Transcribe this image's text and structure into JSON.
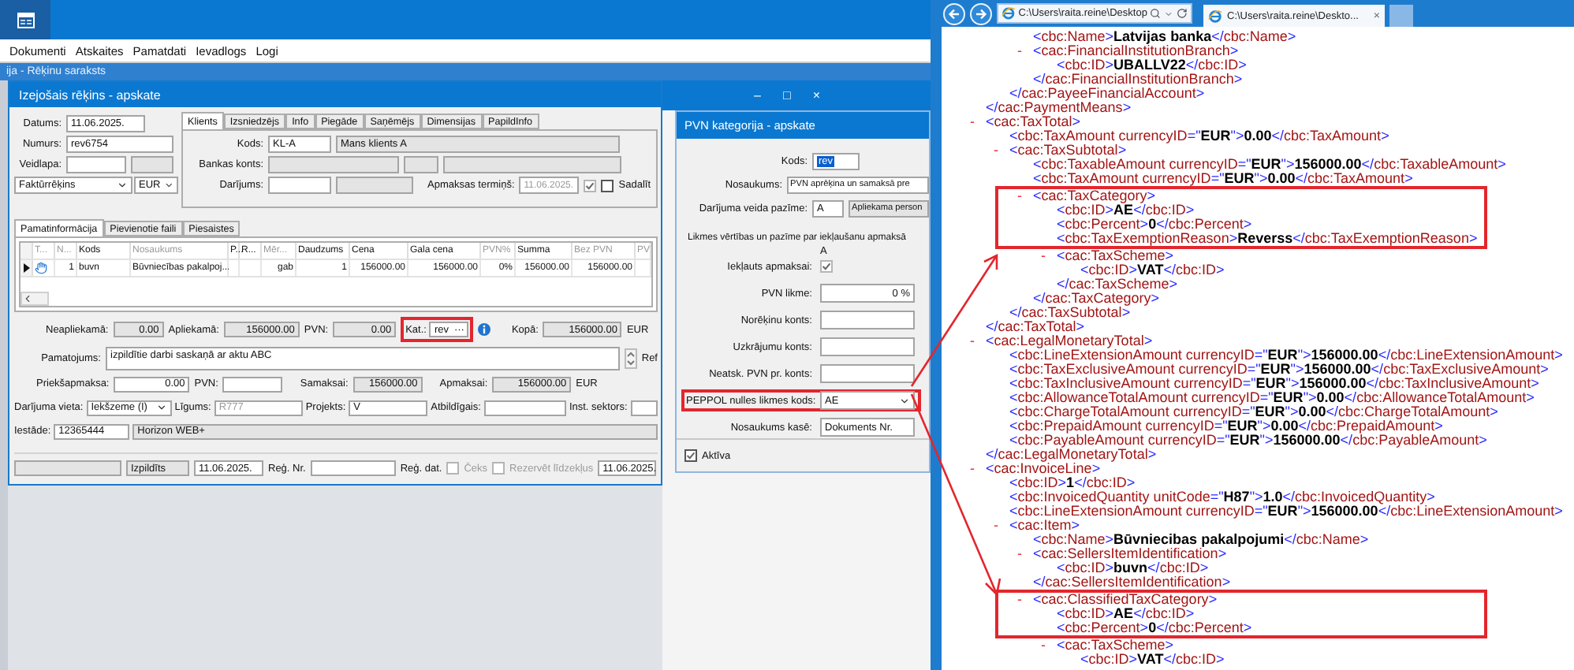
{
  "app": {
    "menu": [
      "Dokumenti",
      "Atskaites",
      "Pamatdati",
      "Ievadlogs",
      "Logi"
    ],
    "background_window_title": "ija - Rēķinu saraksts"
  },
  "invoice": {
    "title": "Izejošais rēķins - apskate",
    "datums": {
      "label": "Datums:",
      "value": "11.06.2025."
    },
    "numurs": {
      "label": "Numurs:",
      "value": "rev6754"
    },
    "veidlapa": {
      "label": "Veidlapa:"
    },
    "doc_type": "Faktūrrēķins",
    "currency": "EUR",
    "client_tabs": [
      {
        "label": "Klients",
        "selected": true
      },
      {
        "label": "Izsniedzējs",
        "selected": false
      },
      {
        "label": "Info",
        "selected": false
      },
      {
        "label": "Piegāde",
        "selected": false
      },
      {
        "label": "Saņēmējs",
        "selected": false
      },
      {
        "label": "Dimensijas",
        "selected": false
      },
      {
        "label": "PapildInfo",
        "selected": false
      }
    ],
    "client": {
      "kods_label": "Kods:",
      "kods": "KL-A",
      "name": "Mans klients A",
      "bank_label": "Bankas konts:",
      "darijums_label": "Darījums:",
      "term_label": "Apmaksas termiņš:",
      "term": "11.06.2025.",
      "term_checked": true,
      "split_label": "Sadalīt",
      "split_checked": false
    },
    "tabs": [
      {
        "label": "Pamatinformācija",
        "selected": true
      },
      {
        "label": "Pievienotie faili",
        "selected": false
      },
      {
        "label": "Piesaistes",
        "selected": false
      }
    ],
    "grid": {
      "columns": [
        {
          "label": "T...",
          "dimmed": true
        },
        {
          "label": "N...",
          "dimmed": true
        },
        {
          "label": "Kods",
          "dimmed": false
        },
        {
          "label": "Nosaukums",
          "dimmed": true
        },
        {
          "label": "P...",
          "dimmed": false
        },
        {
          "label": "R...",
          "dimmed": false
        },
        {
          "label": "Mēr...",
          "dimmed": true
        },
        {
          "label": "Daudzums",
          "dimmed": false
        },
        {
          "label": "Cena",
          "dimmed": false
        },
        {
          "label": "Gala cena",
          "dimmed": false
        },
        {
          "label": "PVN%",
          "dimmed": true
        },
        {
          "label": "Summa",
          "dimmed": false
        },
        {
          "label": "Bez PVN",
          "dimmed": true
        },
        {
          "label": "PV",
          "dimmed": true
        }
      ],
      "rows": [
        {
          "selected": true,
          "cells": [
            null,
            "1",
            "buvn",
            "Būvniecības pakalpoj...",
            null,
            null,
            "gab",
            "1",
            "156000.00",
            "156000.00",
            "0%",
            "156000.00",
            "156000.00",
            null
          ]
        }
      ]
    },
    "totals": [
      {
        "label": "Neapliekamā:",
        "value": "0.00"
      },
      {
        "label": "Apliekamā:",
        "value": "156000.00"
      },
      {
        "label": "PVN:",
        "value": "0.00"
      }
    ],
    "kat": {
      "label": "Kat.:",
      "value": "rev",
      "button": "···",
      "highlighted": true
    },
    "kopa": {
      "label": "Kopā:",
      "value": "156000.00",
      "currency": "EUR"
    },
    "pamatojums": {
      "label": "Pamatojums:",
      "value": "izpildītie darbi saskaņā ar aktu ABC",
      "ref_label": "Ref"
    },
    "payment": {
      "prepay_label": "Priekšapmaksa:",
      "prepay": "0.00",
      "pvn_label": "PVN:",
      "samaksai_label": "Samaksai:",
      "samaksai": "156000.00",
      "apmaksai_label": "Apmaksai:",
      "apmaksai": "156000.00",
      "currency": "EUR"
    },
    "place": {
      "label": "Darījuma vieta:",
      "value": "Iekšzeme (I)",
      "ligums_label": "Līgums:",
      "ligums": "R777",
      "projekts_label": "Projekts:",
      "projekts": "V",
      "atbildigais_label": "Atbildīgais:",
      "sektors_label": "Inst. sektors:"
    },
    "iestade": {
      "label": "Iestāde:",
      "code": "12365444",
      "name": "Horizon WEB+"
    },
    "status": {
      "state": "Izpildīts",
      "date": "11.06.2025.",
      "reg_nr_label": "Reģ. Nr.",
      "reg_dat_label": "Reģ. dat.",
      "ceks_label": "Čeks",
      "ceks_checked": false,
      "reserve_label": "Rezervēt līdzekļus",
      "reserve_checked": false,
      "end_date": "11.06.2025."
    }
  },
  "window_controls": [
    "–",
    "□",
    "×"
  ],
  "pvn_dialog": {
    "title": "PVN kategorija - apskate",
    "kods": {
      "label": "Kods:",
      "value": "rev"
    },
    "nosaukums": {
      "label": "Nosaukums:",
      "value": "PVN aprēķina un samaksā pre"
    },
    "darijums": {
      "label": "Darījuma veida pazīme:",
      "value": "A",
      "description": "Apliekama person"
    },
    "section_title": "Likmes vērtības un pazīme par iekļaušanu apmaksā",
    "column": "A",
    "rows": [
      {
        "kind": "checkbox",
        "label": "Iekļauts apmaksai:",
        "checked": true,
        "highlighted": false
      },
      {
        "kind": "field",
        "label": "PVN likme:",
        "value": "0 %",
        "highlighted": false
      },
      {
        "kind": "field",
        "label": "Norēķinu konts:",
        "highlighted": false
      },
      {
        "kind": "field",
        "label": "Uzkrājumu konts:",
        "highlighted": false
      },
      {
        "kind": "field",
        "label": "Neatsk. PVN pr. konts:",
        "highlighted": false
      },
      {
        "kind": "select",
        "label": "PEPPOL nulles likmes kods:",
        "value": "AE",
        "highlighted": true
      },
      {
        "kind": "field",
        "label": "Nosaukums kasē:",
        "value": "Dokuments Nr.",
        "highlighted": false
      }
    ],
    "active": {
      "label": "Aktīva",
      "checked": true
    }
  },
  "browser": {
    "address": "C:\\Users\\raita.reine\\Desktop",
    "tab": {
      "title": "C:\\Users\\raita.reine\\Deskto...",
      "close": "×"
    }
  },
  "xml": [
    {
      "children": [
        {
          "children": [
            {
              "open": "<cbc:Name>",
              "value": "Latvijas banka",
              "close": "</cbc:Name>"
            },
            {
              "marker": "-",
              "open": "<cac:FinancialInstitutionBranch>",
              "children": [
                {
                  "open": "<cbc:ID>",
                  "value": "UBALLV22",
                  "close": "</cbc:ID>"
                }
              ],
              "end": "</cac:FinancialInstitutionBranch>"
            }
          ],
          "end": "</cac:PayeeFinancialAccount>"
        }
      ],
      "end": "</cac:PaymentMeans>"
    },
    {
      "marker": "-",
      "open": "<cac:TaxTotal>",
      "children": [
        {
          "open": "<cbc:TaxAmount currencyID=\"EUR\">",
          "value": "0.00",
          "close": "</cbc:TaxAmount>"
        },
        {
          "marker": "-",
          "open": "<cac:TaxSubtotal>",
          "children": [
            {
              "open": "<cbc:TaxableAmount currencyID=\"EUR\">",
              "value": "156000.00",
              "close": "</cbc:TaxableAmount>"
            },
            {
              "open": "<cbc:TaxAmount currencyID=\"EUR\">",
              "value": "0.00",
              "close": "</cbc:TaxAmount>"
            },
            {
              "marker": "-",
              "open": "<cac:TaxCategory>",
              "highlighted": true,
              "children": [
                {
                  "open": "<cbc:ID>",
                  "value": "AE",
                  "close": "</cbc:ID>",
                  "highlighted": true
                },
                {
                  "open": "<cbc:Percent>",
                  "value": "0",
                  "close": "</cbc:Percent>",
                  "highlighted": true
                },
                {
                  "open": "<cbc:TaxExemptionReason>",
                  "value": "Reverss",
                  "close": "</cbc:TaxExemptionReason>",
                  "highlighted": true
                },
                {
                  "marker": "-",
                  "open": "<cac:TaxScheme>",
                  "children": [
                    {
                      "open": "<cbc:ID>",
                      "value": "VAT",
                      "close": "</cbc:ID>"
                    }
                  ],
                  "end": "</cac:TaxScheme>"
                }
              ],
              "end": "</cac:TaxCategory>"
            }
          ],
          "end": "</cac:TaxSubtotal>"
        }
      ],
      "end": "</cac:TaxTotal>"
    },
    {
      "marker": "-",
      "open": "<cac:LegalMonetaryTotal>",
      "children": [
        {
          "open": "<cbc:LineExtensionAmount currencyID=\"EUR\">",
          "value": "156000.00",
          "close": "</cbc:LineExtensionAmount>"
        },
        {
          "open": "<cbc:TaxExclusiveAmount currencyID=\"EUR\">",
          "value": "156000.00",
          "close": "</cbc:TaxExclusiveAmount>"
        },
        {
          "open": "<cbc:TaxInclusiveAmount currencyID=\"EUR\">",
          "value": "156000.00",
          "close": "</cbc:TaxInclusiveAmount>"
        },
        {
          "open": "<cbc:AllowanceTotalAmount currencyID=\"EUR\">",
          "value": "0.00",
          "close": "</cbc:AllowanceTotalAmount>"
        },
        {
          "open": "<cbc:ChargeTotalAmount currencyID=\"EUR\">",
          "value": "0.00",
          "close": "</cbc:ChargeTotalAmount>"
        },
        {
          "open": "<cbc:PrepaidAmount currencyID=\"EUR\">",
          "value": "0.00",
          "close": "</cbc:PrepaidAmount>"
        },
        {
          "open": "<cbc:PayableAmount currencyID=\"EUR\">",
          "value": "156000.00",
          "close": "</cbc:PayableAmount>"
        }
      ],
      "end": "</cac:LegalMonetaryTotal>"
    },
    {
      "marker": "-",
      "open": "<cac:InvoiceLine>",
      "children": [
        {
          "open": "<cbc:ID>",
          "value": "1",
          "close": "</cbc:ID>"
        },
        {
          "open": "<cbc:InvoicedQuantity unitCode=\"H87\">",
          "value": "1.0",
          "close": "</cbc:InvoicedQuantity>"
        },
        {
          "open": "<cbc:LineExtensionAmount currencyID=\"EUR\">",
          "value": "156000.00",
          "close": "</cbc:LineExtensionAmount>"
        },
        {
          "marker": "-",
          "open": "<cac:Item>",
          "children": [
            {
              "open": "<cbc:Name>",
              "value": "Būvniecibas pakalpojumi",
              "close": "</cbc:Name>"
            },
            {
              "marker": "-",
              "open": "<cac:SellersItemIdentification>",
              "children": [
                {
                  "open": "<cbc:ID>",
                  "value": "buvn",
                  "close": "</cbc:ID>"
                }
              ],
              "end": "</cac:SellersItemIdentification>"
            },
            {
              "marker": "-",
              "open": "<cac:ClassifiedTaxCategory>",
              "highlighted": true,
              "children": [
                {
                  "open": "<cbc:ID>",
                  "value": "AE",
                  "close": "</cbc:ID>",
                  "highlighted": true
                },
                {
                  "open": "<cbc:Percent>",
                  "value": "0",
                  "close": "</cbc:Percent>",
                  "highlighted": true
                },
                {
                  "marker": "-",
                  "open": "<cac:TaxScheme>",
                  "children": [
                    {
                      "open": "<cbc:ID>",
                      "value": "VAT",
                      "close": "</cbc:ID>"
                    }
                  ]
                }
              ]
            }
          ]
        }
      ]
    }
  ]
}
